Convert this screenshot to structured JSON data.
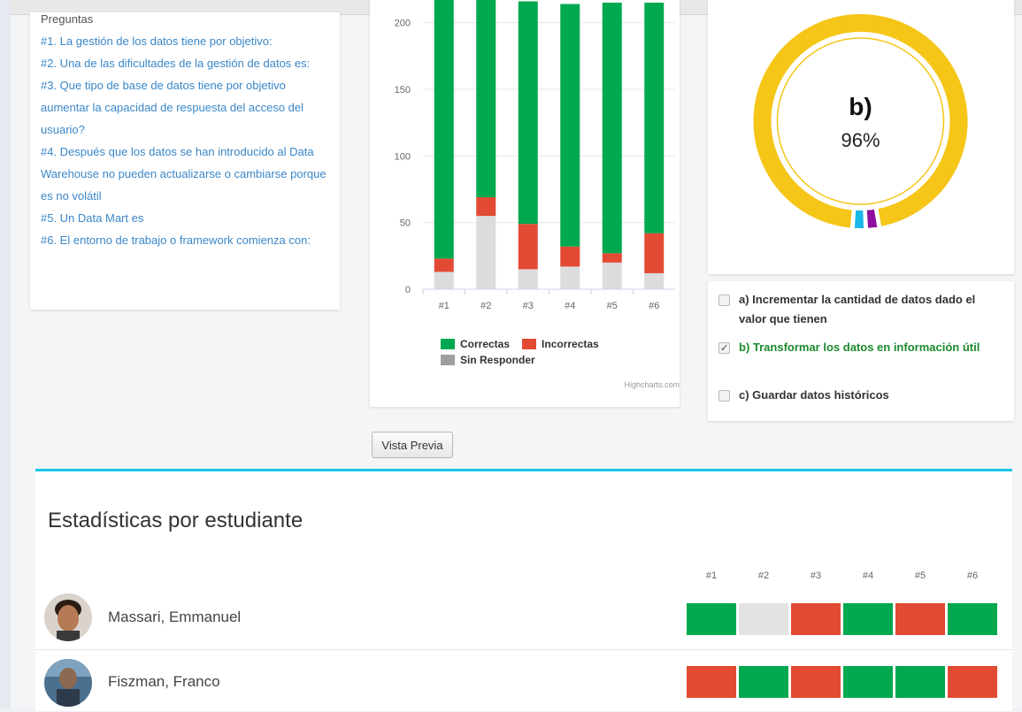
{
  "questions": {
    "title": "Preguntas",
    "items": [
      "#1. La gestión de los datos tiene por objetivo:",
      "#2. Una de las dificultades de la gestión de datos es:",
      "#3. Que tipo de base de datos tiene por objetivo aumentar la capacidad de respuesta del acceso del usuario?",
      "#4. Después que los datos se han introducido al Data Warehouse no pueden actualizarse o cambiarse porque es no volátil",
      "#5. Un Data Mart es",
      "#6. El entorno de trabajo o framework comienza con:"
    ]
  },
  "chart_data": [
    {
      "type": "bar",
      "stacked": true,
      "categories": [
        "#1",
        "#2",
        "#3",
        "#4",
        "#5",
        "#6"
      ],
      "series": [
        {
          "name": "Correctas",
          "color": "#00a84f",
          "values": [
            194,
            150,
            167,
            182,
            188,
            173
          ]
        },
        {
          "name": "Incorrectas",
          "color": "#e34a33",
          "values": [
            10,
            14,
            34,
            15,
            7,
            30
          ]
        },
        {
          "name": "Sin Responder",
          "color": "#9e9e9e",
          "values": [
            13,
            55,
            15,
            17,
            20,
            12
          ]
        }
      ],
      "y_ticks": [
        "0",
        "50",
        "100",
        "150",
        "200"
      ],
      "ylim": [
        0,
        217
      ],
      "legend": "bottom",
      "credits": "Highcharts.com"
    },
    {
      "type": "pie",
      "donut": true,
      "label": "b)",
      "value_text": "96%",
      "slices": [
        {
          "name": "b)",
          "value": 96,
          "color": "#f5c518"
        },
        {
          "name": "a)",
          "value": 2,
          "color": "#8e0e9e"
        },
        {
          "name": "c)",
          "value": 2,
          "color": "#19b8e8"
        }
      ]
    }
  ],
  "options": [
    {
      "text": "a) Incrementar la cantidad de datos dado el valor que tienen",
      "checked": false,
      "correct": false
    },
    {
      "text": "b) Transformar los datos en información útil",
      "checked": true,
      "correct": true
    },
    {
      "text": "c) Guardar datos históricos",
      "checked": false,
      "correct": false
    }
  ],
  "preview_button": "Vista Previa",
  "stats": {
    "title": "Estadísticas por estudiante",
    "question_labels": [
      "#1",
      "#2",
      "#3",
      "#4",
      "#5",
      "#6"
    ],
    "students": [
      {
        "name": "Massari, Emmanuel",
        "results": [
          "correct",
          "unanswered",
          "incorrect",
          "correct",
          "incorrect",
          "correct"
        ]
      },
      {
        "name": "Fiszman, Franco",
        "results": [
          "incorrect",
          "correct",
          "incorrect",
          "correct",
          "correct",
          "incorrect"
        ]
      }
    ]
  },
  "colors": {
    "correct": "#00a84f",
    "incorrect": "#e34a33",
    "unanswered": "#e3e3e3",
    "accent": "#18c4ea",
    "link": "#3a87c8"
  }
}
